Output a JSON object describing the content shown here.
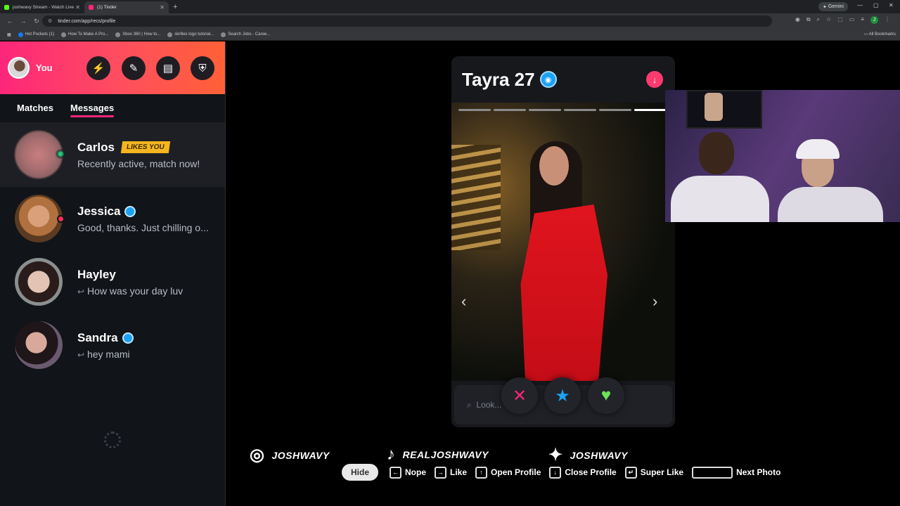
{
  "browser": {
    "tabs": [
      {
        "title": "joshwavy Stream - Watch Live o",
        "fav_color": "#53fc18",
        "active": false
      },
      {
        "title": "(1) Tinder",
        "fav_color": "#fd267a",
        "active": true
      }
    ],
    "new_tab": "+",
    "gemini_label": "Gemini",
    "url": "tinder.com/app/recs/profile",
    "bookmarks": [
      "Hot Pockets (1)",
      "How To Make A Pro...",
      "Xbox 360 | How to...",
      "skrillex logo tutorial...",
      "Search Jobs - Caree..."
    ],
    "all_bookmarks": "All Bookmarks",
    "profile_initial": "J"
  },
  "sidebar": {
    "me_label": "You",
    "header_buttons": [
      "boost-icon",
      "explore-icon",
      "briefcase-icon",
      "shield-icon"
    ],
    "tabs": [
      {
        "label": "Matches",
        "selected": false
      },
      {
        "label": "Messages",
        "selected": true
      }
    ],
    "conversations": [
      {
        "name": "Carlos",
        "badge": "LIKES YOU",
        "message": "Recently active, match now!",
        "verified": false,
        "status": "online"
      },
      {
        "name": "Jessica",
        "badge": "",
        "message": "Good, thanks. Just chilling o...",
        "verified": true,
        "status": "unread"
      },
      {
        "name": "Hayley",
        "badge": "",
        "message": "How was your day luv",
        "verified": false,
        "status": "replied"
      },
      {
        "name": "Sandra",
        "badge": "",
        "message": "hey mami",
        "verified": true,
        "status": "replied"
      }
    ]
  },
  "profile": {
    "name_age": "Tayra 27",
    "photo_count": 6,
    "current_photo": 6,
    "search_placeholder": "Look..."
  },
  "socials": [
    {
      "icon": "instagram-icon",
      "handle": "JOSHWAVY"
    },
    {
      "icon": "tiktok-icon",
      "handle": "REALJOSHWAVY"
    },
    {
      "icon": "twitter-icon",
      "handle": "JOSHWAVY"
    }
  ],
  "hotkeys": {
    "hide_label": "Hide",
    "items": [
      {
        "key": "←",
        "label": "Nope"
      },
      {
        "key": "→",
        "label": "Like"
      },
      {
        "key": "↑",
        "label": "Open Profile"
      },
      {
        "key": "↓",
        "label": "Close Profile"
      },
      {
        "key": "↵",
        "label": "Super Like"
      },
      {
        "key": "",
        "label": "Next Photo"
      }
    ]
  },
  "colors": {
    "brand_pink": "#fd267a",
    "brand_orange": "#ff6036",
    "likes_badge": "#f5b51f",
    "verified_blue": "#1da1f2"
  }
}
